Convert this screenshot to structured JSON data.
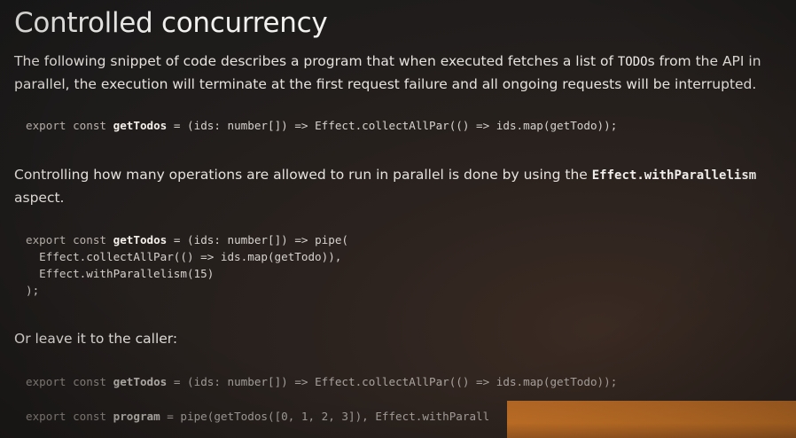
{
  "slide": {
    "title": "Controlled concurrency",
    "intro_line1_prefix": "The following snippet of code describes a program that when executed fetches a list of ",
    "intro_line1_code": "TODO",
    "intro_line1_suffix": "s from the API in",
    "intro_line2": "parallel, the execution will terminate at the first request failure and all ongoing requests will be interrupted.",
    "code1": {
      "export": "export",
      "const": "const",
      "name": "getTodos",
      "rest": " = (ids: number[]) => Effect.collectAllPar(() => ids.map(getTodo));"
    },
    "para2_line1": "Controlling how many operations are allowed to run in parallel is done by using the ",
    "para2_code": "Effect.withParallelism",
    "para2_line2": "aspect.",
    "code2": {
      "line1_export": "export",
      "line1_const": "const",
      "line1_name": "getTodos",
      "line1_rest": " = (ids: number[]) => pipe(",
      "line2": "  Effect.collectAllPar(() => ids.map(getTodo)),",
      "line3": "  Effect.withParallelism(15)",
      "line4": ");"
    },
    "para3": "Or leave it to the caller:",
    "code3": {
      "export": "export",
      "const": "const",
      "name": "getTodos",
      "rest": " = (ids: number[]) => Effect.collectAllPar(() => ids.map(getTodo));"
    },
    "code4": {
      "export": "export",
      "const": "const",
      "name": "program",
      "rest": " = pipe(getTodos([0, 1, 2, 3]), Effect.withParall"
    }
  },
  "colors": {
    "background": "#1f1c1b",
    "text": "#e6e2de",
    "accent_orange": "#c77427"
  }
}
